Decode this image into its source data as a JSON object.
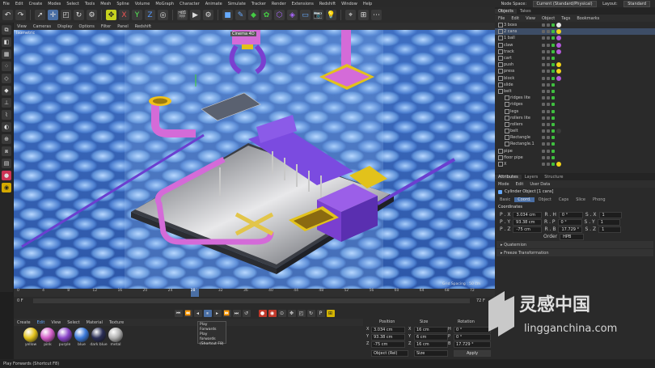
{
  "menu": [
    "File",
    "Edit",
    "Create",
    "Modes",
    "Select",
    "Tools",
    "Mesh",
    "Spline",
    "Volume",
    "MoGraph",
    "Character",
    "Animate",
    "Simulate",
    "Tracker",
    "Render",
    "Extensions",
    "Redshift",
    "Window",
    "Help"
  ],
  "node_space": {
    "label": "Node Space:",
    "value": "Current (Standard/Physical)"
  },
  "layout": {
    "label": "Layout:",
    "value": "Standard"
  },
  "viewport": {
    "menu": [
      "View",
      "Cameras",
      "Display",
      "Options",
      "Filter",
      "Panel",
      "Redshift"
    ],
    "camera_label": "Isometric",
    "grid_spacing": "Grid Spacing : 50 cm",
    "floating_label": "Cinema 4D"
  },
  "object_manager": {
    "tabs": [
      "Objects",
      "Takes"
    ],
    "menu": [
      "File",
      "Edit",
      "View",
      "Object",
      "Tags",
      "Bookmarks"
    ],
    "objects": [
      {
        "name": "3 boxs",
        "ball": "#e8e8e8"
      },
      {
        "name": "2 cans",
        "ball": "#f1d21a"
      },
      {
        "name": "1 ball",
        "ball": "#b25ad8"
      },
      {
        "name": "claw",
        "ball": "#b25ad8"
      },
      {
        "name": "track",
        "ball": "#b25ad8"
      },
      {
        "name": "cart",
        "ball": ""
      },
      {
        "name": "push",
        "ball": "#f1d21a"
      },
      {
        "name": "press",
        "ball": "#f1d21a"
      },
      {
        "name": "block",
        "ball": "#b25ad8"
      },
      {
        "name": "slide",
        "ball": ""
      },
      {
        "name": "belt",
        "ball": ""
      },
      {
        "name": "ridges lite",
        "ball": ""
      },
      {
        "name": "ridges",
        "ball": ""
      },
      {
        "name": "legs",
        "ball": ""
      },
      {
        "name": "rollers lite",
        "ball": ""
      },
      {
        "name": "rollers",
        "ball": ""
      },
      {
        "name": "belt",
        "ball": "#3a3a3a"
      },
      {
        "name": "Rectangle",
        "ball": ""
      },
      {
        "name": "Rectangle.1",
        "ball": ""
      },
      {
        "name": "pipe",
        "ball": ""
      },
      {
        "name": "floor pipe",
        "ball": ""
      },
      {
        "name": "X",
        "ball": "#f1d21a"
      }
    ]
  },
  "attributes": {
    "tabs": [
      "Attributes",
      "Layers",
      "Structure"
    ],
    "menu": [
      "Mode",
      "Edit",
      "User Data"
    ],
    "object_title": "Cylinder Object [1 cans]",
    "obj_tabs": [
      "Basic",
      "Coord.",
      "Object",
      "Caps",
      "Slice",
      "Phong"
    ],
    "section": "Coordinates",
    "rows": [
      {
        "p_label": "P . X",
        "p": "3.034 cm",
        "s_label": "S . X",
        "s": "1",
        "r_label": "R . H",
        "r": "0 °"
      },
      {
        "p_label": "P . Y",
        "p": "93.38 cm",
        "s_label": "S . Y",
        "s": "1",
        "r_label": "R . P",
        "r": "0 °"
      },
      {
        "p_label": "P . Z",
        "p": "-75 cm",
        "s_label": "S . Z",
        "s": "1",
        "r_label": "R . B",
        "r": "17.729 °"
      }
    ],
    "order_label": "Order",
    "order_value": "HPB",
    "folds": [
      "Quaternion",
      "Freeze Transformation"
    ]
  },
  "timeline": {
    "ticks": [
      "0",
      "4",
      "8",
      "12",
      "16",
      "20",
      "24",
      "28",
      "32",
      "36",
      "40",
      "44",
      "48",
      "52",
      "56",
      "60",
      "64",
      "68",
      "72"
    ],
    "current_frame": "28",
    "start": "0 F",
    "end": "72 F"
  },
  "materials": {
    "menu": [
      "Create",
      "Edit",
      "View",
      "Select",
      "Material",
      "Texture"
    ],
    "items": [
      {
        "name": "yellow",
        "color": "#e2c21b"
      },
      {
        "name": "pink",
        "color": "#d15cc7"
      },
      {
        "name": "purple",
        "color": "#8a45c9"
      },
      {
        "name": "blue",
        "color": "#3a78d8"
      },
      {
        "name": "dark blue",
        "color": "#2a2e55"
      },
      {
        "name": "metal",
        "color": "#b0b0b0"
      }
    ]
  },
  "tooltip": {
    "line1": "Play Forwards",
    "line2": "Play forwards",
    "line3": "(Shortcut F8)"
  },
  "coordinates": {
    "headers": [
      "Position",
      "Size",
      "Rotation"
    ],
    "rows": [
      {
        "axis": "X",
        "pos": "3.034 cm",
        "size_axis": "X",
        "size": "16 cm",
        "rot_axis": "H",
        "rot": "0 °"
      },
      {
        "axis": "Y",
        "pos": "93.38 cm",
        "size_axis": "Y",
        "size": "6 cm",
        "rot_axis": "P",
        "rot": "0 °"
      },
      {
        "axis": "Z",
        "pos": "-75 cm",
        "size_axis": "Z",
        "size": "16 cm",
        "rot_axis": "B",
        "rot": "17.729 °"
      }
    ],
    "mode": "Object (Rel)",
    "size_mode": "Size",
    "apply": "Apply"
  },
  "status": "Play Forwards (Shortcut F8)",
  "watermark": {
    "cn": "灵感中国",
    "url": "lingganchina.com"
  }
}
